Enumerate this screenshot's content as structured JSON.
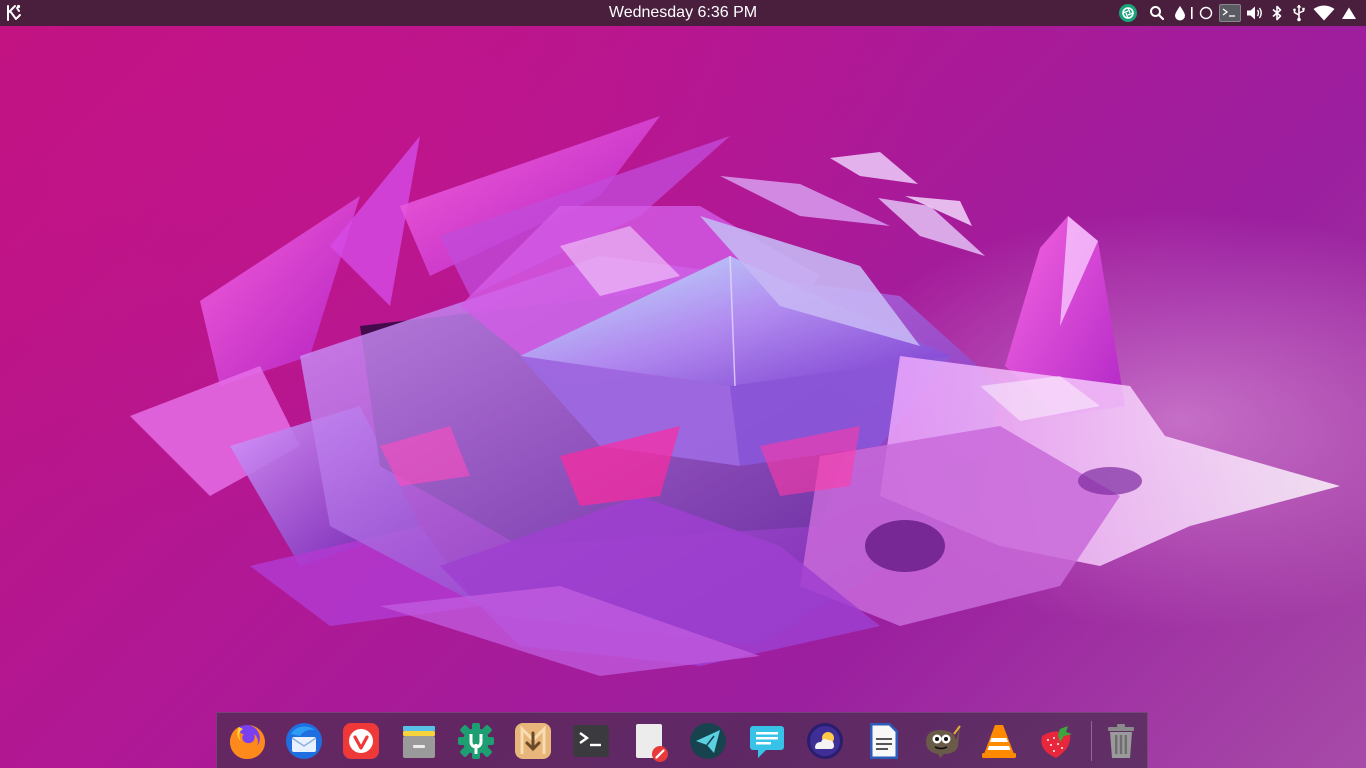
{
  "panel": {
    "clock": "Wednesday 6:36 PM",
    "background": "#4a1f3e",
    "launcher_icon": "kde-launcher-icon",
    "tray": [
      {
        "name": "app-indicator-icon",
        "color": "#1aa37a"
      },
      {
        "name": "search-icon"
      },
      {
        "name": "color-picker-icon"
      },
      {
        "name": "separator-icon"
      },
      {
        "name": "night-mode-icon"
      },
      {
        "name": "terminal-indicator-icon"
      },
      {
        "name": "volume-icon"
      },
      {
        "name": "bluetooth-icon"
      },
      {
        "name": "usb-icon"
      },
      {
        "name": "wifi-icon"
      },
      {
        "name": "power-icon"
      }
    ]
  },
  "wallpaper": {
    "colors": [
      "#c2127e",
      "#9b1f9f",
      "#e040d0",
      "#9ec7ef",
      "#1d0a2a"
    ]
  },
  "dock": {
    "items": [
      {
        "name": "firefox-icon",
        "app": "Firefox"
      },
      {
        "name": "thunderbird-icon",
        "app": "Thunderbird"
      },
      {
        "name": "vivaldi-icon",
        "app": "Vivaldi"
      },
      {
        "name": "file-manager-icon",
        "app": "Files"
      },
      {
        "name": "settings-icon",
        "app": "Settings"
      },
      {
        "name": "downloader-icon",
        "app": "Downloader"
      },
      {
        "name": "terminal-icon",
        "app": "Terminal"
      },
      {
        "name": "text-editor-icon",
        "app": "Text Editor"
      },
      {
        "name": "telegram-icon",
        "app": "Telegram"
      },
      {
        "name": "chat-icon",
        "app": "Messages"
      },
      {
        "name": "weather-icon",
        "app": "Weather"
      },
      {
        "name": "document-icon",
        "app": "Writer"
      },
      {
        "name": "gimp-icon",
        "app": "GIMP"
      },
      {
        "name": "vlc-icon",
        "app": "VLC"
      },
      {
        "name": "strawberry-icon",
        "app": "Strawberry"
      },
      {
        "name": "trash-icon",
        "app": "Trash"
      }
    ]
  }
}
